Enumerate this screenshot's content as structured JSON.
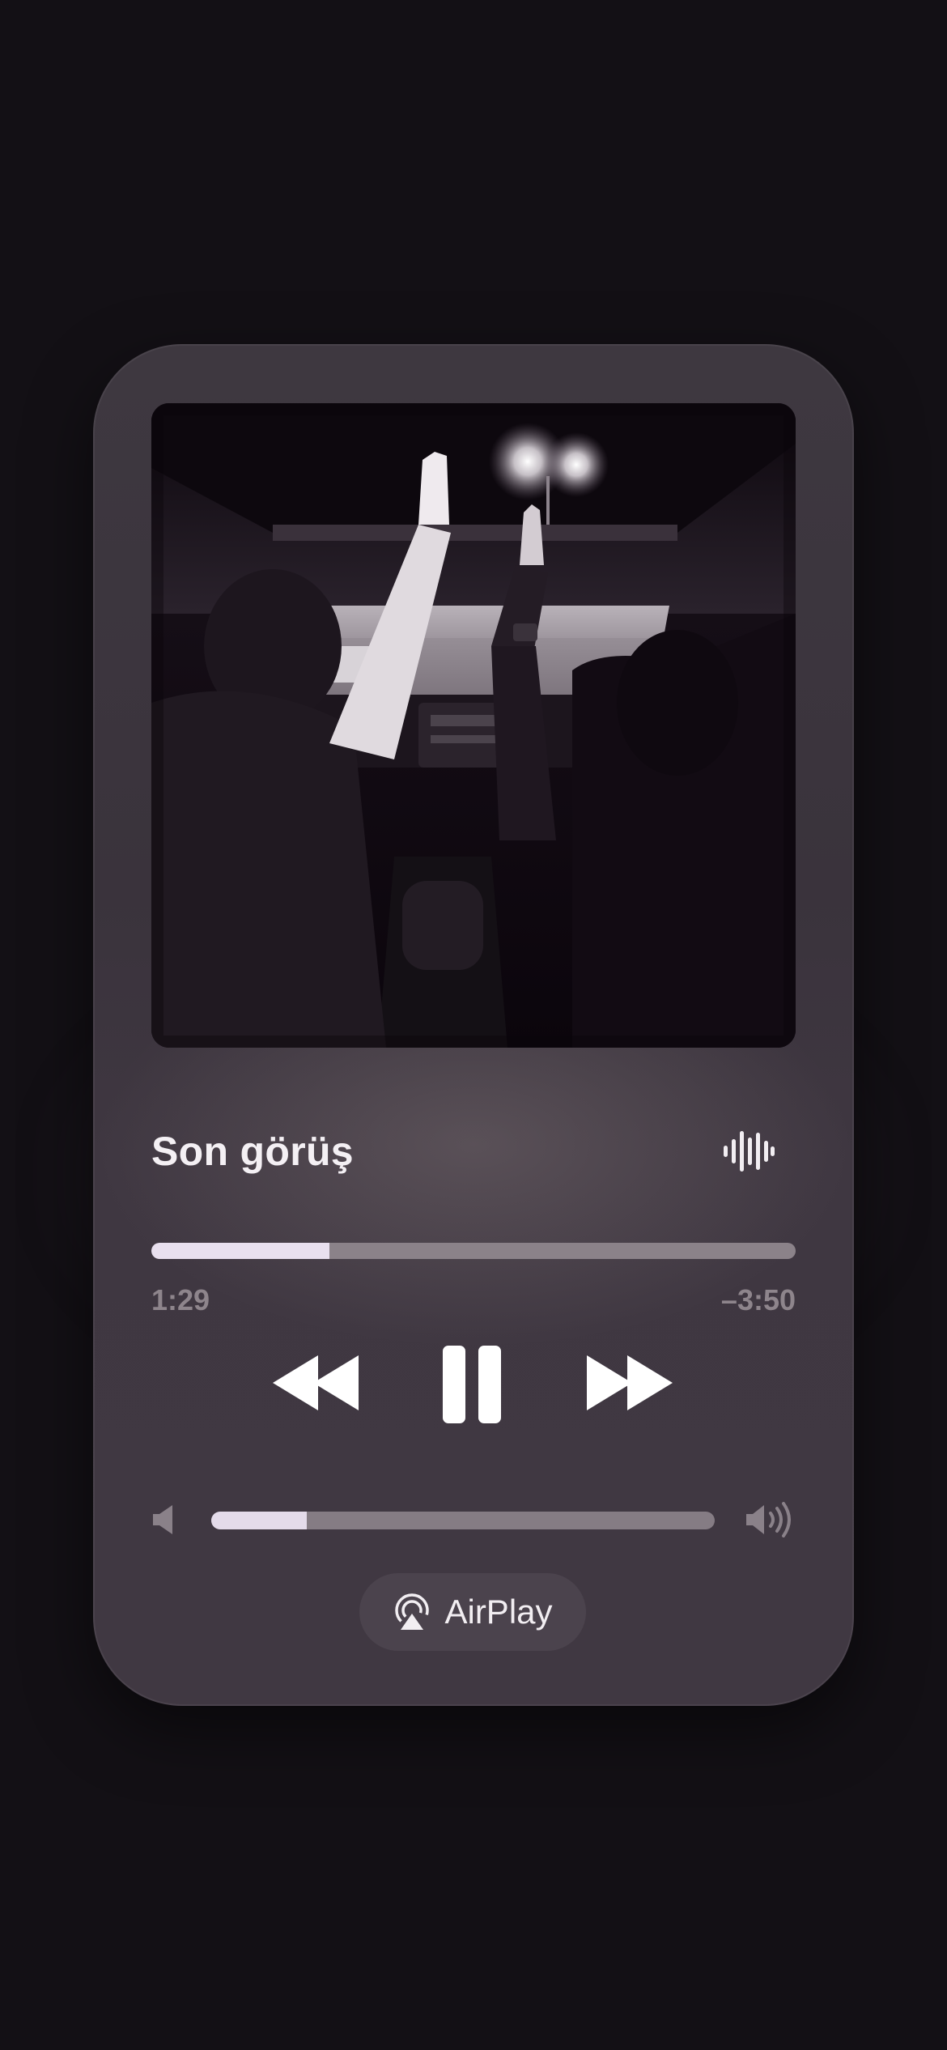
{
  "player": {
    "song_title": "Son görüş",
    "time_elapsed": "1:29",
    "time_remaining": "–3:50",
    "progress_fraction": 0.277,
    "volume_fraction": 0.19,
    "airplay_label": "AirPlay",
    "state": "playing"
  },
  "icons": {
    "waveform": "waveform-icon",
    "rewind": "backward-icon",
    "pause": "pause-icon",
    "forward": "forward-icon",
    "volume_low": "speaker-icon",
    "volume_high": "speaker-wave-icon",
    "airplay": "airplay-icon"
  },
  "colors": {
    "background": "#131015",
    "card": "#3e3840",
    "accent_fill": "#e9e0ef",
    "track": "#8b8289",
    "secondary_text": "#8e858c"
  }
}
